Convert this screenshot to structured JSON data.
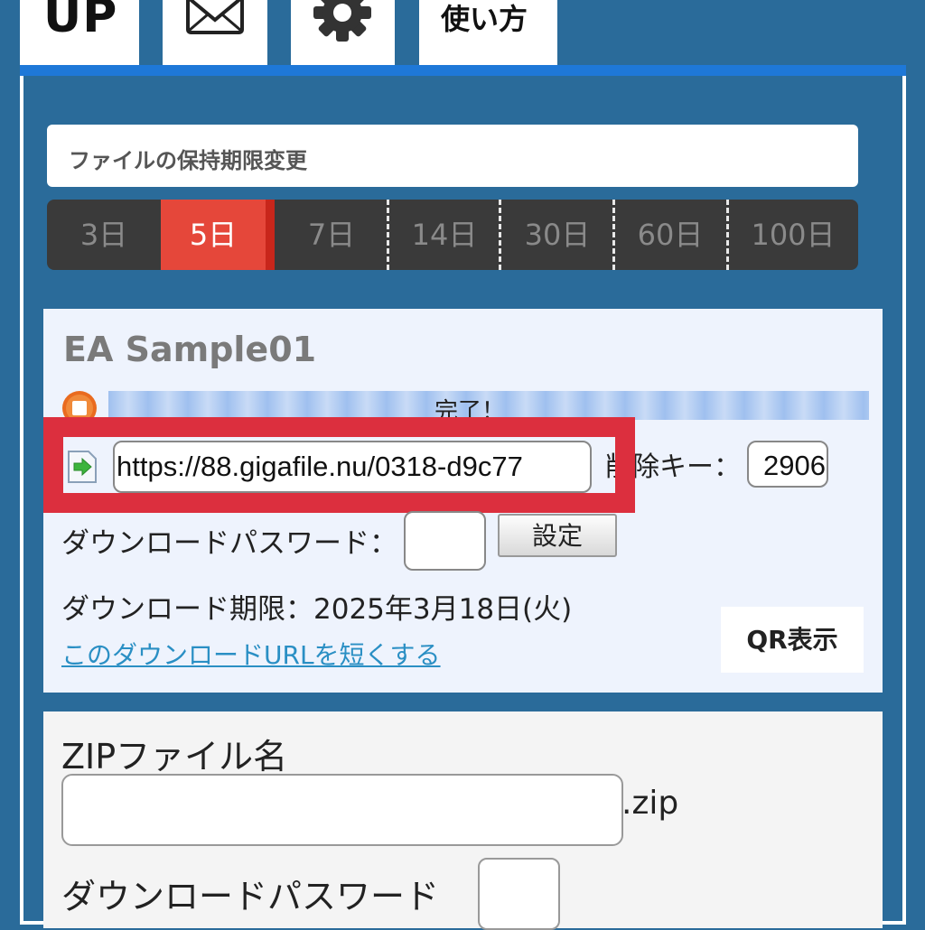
{
  "tabs": {
    "upload_label": "UP",
    "mail_icon": "envelope-icon",
    "settings_icon": "gear-icon",
    "howto_label": "使い方"
  },
  "retention": {
    "label": "ファイルの保持期限変更",
    "options": [
      "3日",
      "5日",
      "7日",
      "14日",
      "30日",
      "60日",
      "100日"
    ],
    "selected": "5日"
  },
  "file": {
    "name": "EA Sample01",
    "status_icon": "stop-icon",
    "progress_label": "完了！",
    "progress": 1.0,
    "link_icon": "arrow-document-icon",
    "url": "https://88.gigafile.nu/0318-d9c77",
    "delete_key_label": "削除キー：",
    "delete_key_value": "2906",
    "download_password_label": "ダウンロードパスワード：",
    "set_button": "設定",
    "deadline": "ダウンロード期限：2025年3月18日(火)",
    "shorten_link": "このダウンロードURLを短くする",
    "qr_button": "QR表示"
  },
  "zip": {
    "title": "ZIPファイル名",
    "extension": ".zip",
    "password_label": "ダウンロードパスワード"
  },
  "colors": {
    "background": "#2a6b9a",
    "accent_blue": "#1e78d8",
    "active_day": "#e5473a",
    "highlight": "#dc2f3e",
    "link": "#2a8fc4"
  }
}
